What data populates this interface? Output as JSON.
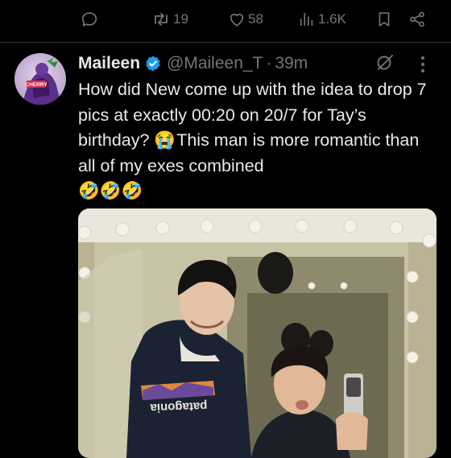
{
  "actions": {
    "reply_count": "",
    "retweet_count": "19",
    "like_count": "58",
    "views_count": "1.6K"
  },
  "tweet": {
    "display_name": "Maileen",
    "handle": "@Maileen_T",
    "separator": "·",
    "time": "39m",
    "text_1": "How did New come up with the idea to drop 7 pics at exactly 00:20 on 20/7 for Tay’s birthday? ",
    "text_2": "This man is more romantic than all of my exes combined",
    "emoji_reaction": "😭",
    "emoji_laugh": "🤣🤣🤣"
  },
  "media": {
    "shirt_text": "patagonia"
  },
  "avatar": {
    "badge_text": "CHERRY"
  },
  "colors": {
    "background": "#000000",
    "text": "#e7e9ea",
    "muted": "#71767b",
    "verified": "#1d9bf0"
  },
  "icons": [
    "reply-icon",
    "retweet-icon",
    "like-icon",
    "views-icon",
    "bookmark-icon",
    "share-icon",
    "verified-icon",
    "grok-icon",
    "more-icon"
  ]
}
